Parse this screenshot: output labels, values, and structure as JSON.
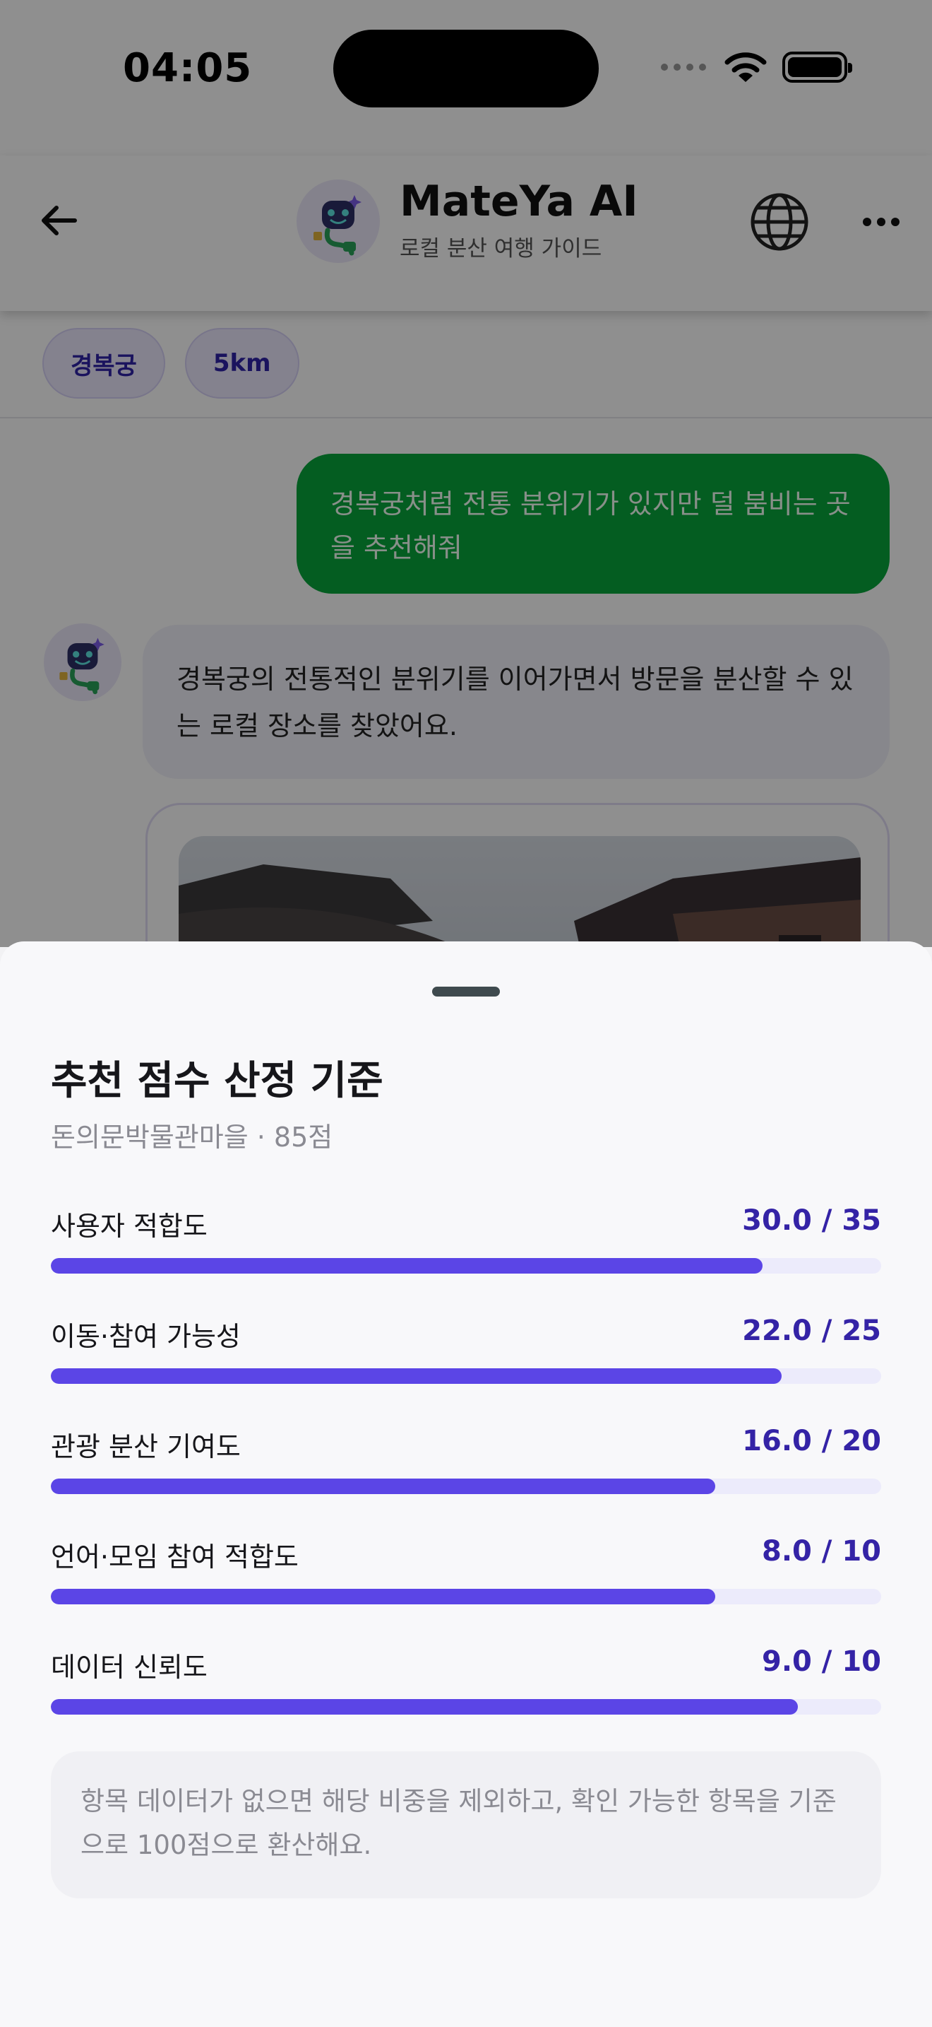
{
  "status_bar": {
    "time": "04:05"
  },
  "header": {
    "title": "MateYa AI",
    "subtitle": "로컬 분산 여행 가이드"
  },
  "chips": [
    {
      "label": "경복궁"
    },
    {
      "label": "5km"
    }
  ],
  "chat": {
    "user_message": "경복궁처럼 전통 분위기가 있지만 덜 붐비는 곳을 추천해줘",
    "bot_message": "경복궁의 전통적인 분위기를 이어가면서 방문을 분산할 수 있는 로컬 장소를 찾았어요."
  },
  "sheet": {
    "title": "추천 점수 산정 기준",
    "subtitle": "돈의문박물관마을 · 85점",
    "criteria": [
      {
        "label": "사용자 적합도",
        "score": 30.0,
        "max": 35,
        "display": "30.0 / 35"
      },
      {
        "label": "이동·참여 가능성",
        "score": 22.0,
        "max": 25,
        "display": "22.0 / 25"
      },
      {
        "label": "관광 분산 기여도",
        "score": 16.0,
        "max": 20,
        "display": "16.0 / 20"
      },
      {
        "label": "언어·모임 참여 적합도",
        "score": 8.0,
        "max": 10,
        "display": "8.0 / 10"
      },
      {
        "label": "데이터 신뢰도",
        "score": 9.0,
        "max": 10,
        "display": "9.0 / 10"
      }
    ],
    "note": "항목 데이터가 없으면 해당 비중을 제외하고, 확인 가능한 항목을 기준으로 100점으로 환산해요."
  },
  "colors": {
    "accent": "#5b45e6",
    "track": "#ecebfb",
    "user_bubble": "#08a63c",
    "score_text": "#3423a6"
  },
  "icons": {
    "back": "arrow-left-icon",
    "language": "globe-icon",
    "more": "more-horizontal-icon"
  }
}
